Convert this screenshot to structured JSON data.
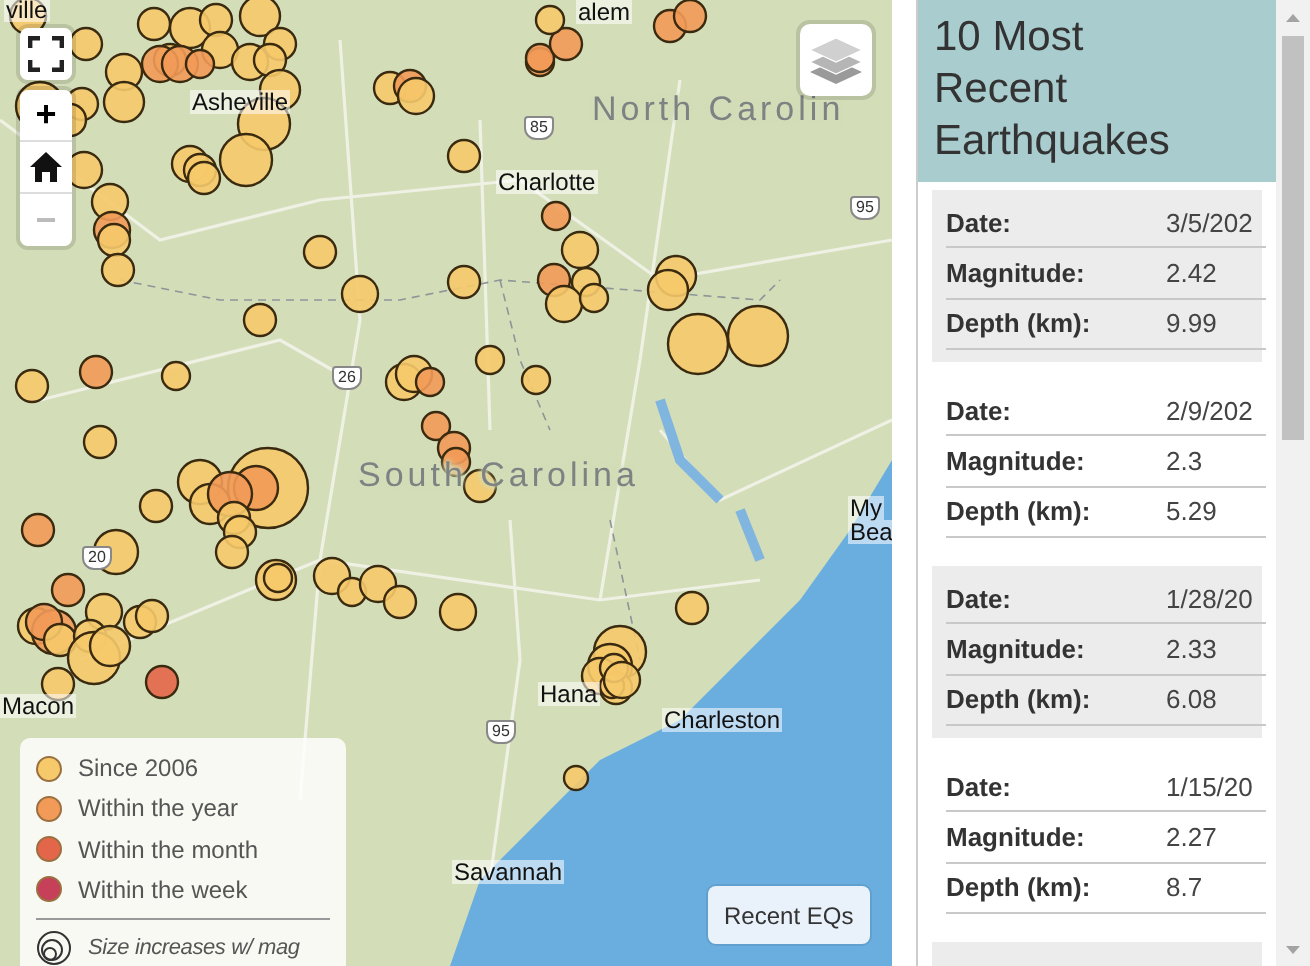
{
  "map": {
    "place_labels": [
      {
        "text": "ville",
        "kind": "city"
      },
      {
        "text": "alem",
        "kind": "city"
      },
      {
        "text": "Asheville",
        "kind": "city"
      },
      {
        "text": "Charlotte",
        "kind": "city"
      },
      {
        "text": "North Carolin",
        "kind": "region"
      },
      {
        "text": "South Carolina",
        "kind": "region"
      },
      {
        "text": "My",
        "kind": "city"
      },
      {
        "text": "Bea",
        "kind": "city"
      },
      {
        "text": "Hana",
        "kind": "city"
      },
      {
        "text": "Charleston",
        "kind": "city"
      },
      {
        "text": "Macon",
        "kind": "city"
      },
      {
        "text": "Savannah",
        "kind": "city"
      }
    ],
    "highway_shields": [
      "85",
      "95",
      "26",
      "20",
      "95"
    ],
    "zoom_in": {
      "label": "+",
      "disabled": false
    },
    "zoom_out": {
      "label": "−",
      "disabled": true
    },
    "legend": {
      "items": [
        {
          "label": "Since 2006",
          "color": "#f6c96a"
        },
        {
          "label": "Within the year",
          "color": "#f29a58"
        },
        {
          "label": "Within the month",
          "color": "#e4664a"
        },
        {
          "label": "Within the week",
          "color": "#c7405a"
        }
      ],
      "size_note": "Size increases w/ mag"
    },
    "recent_button": "Recent EQs"
  },
  "panel": {
    "title": "10 Most Recent Earthquakes",
    "quakes": [
      {
        "fields": [
          {
            "label": "Date:",
            "value": "3/5/202"
          },
          {
            "label": "Magnitude:",
            "value": "2.42"
          },
          {
            "label": "Depth (km):",
            "value": "9.99"
          }
        ]
      },
      {
        "fields": [
          {
            "label": "Date:",
            "value": "2/9/202"
          },
          {
            "label": "Magnitude:",
            "value": "2.3"
          },
          {
            "label": "Depth (km):",
            "value": "5.29"
          }
        ]
      },
      {
        "fields": [
          {
            "label": "Date:",
            "value": "1/28/20"
          },
          {
            "label": "Magnitude:",
            "value": "2.33"
          },
          {
            "label": "Depth (km):",
            "value": "6.08"
          }
        ]
      },
      {
        "fields": [
          {
            "label": "Date:",
            "value": "1/15/20"
          },
          {
            "label": "Magnitude:",
            "value": "2.27"
          },
          {
            "label": "Depth (km):",
            "value": "8.7"
          }
        ]
      }
    ]
  }
}
